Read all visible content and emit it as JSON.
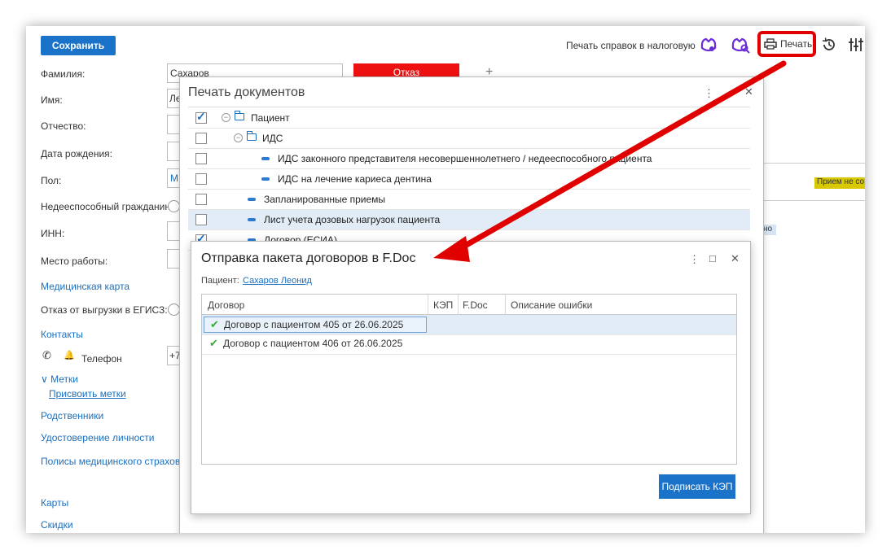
{
  "toolbar": {
    "save_label": "Сохранить",
    "print_tax_label": "Печать справок в налоговую",
    "print_label": "Печать"
  },
  "form": {
    "fields": [
      {
        "label": "Фамилия:",
        "value": "Сахаров"
      },
      {
        "label": "Имя:",
        "value": "Ле"
      },
      {
        "label": "Отчество:",
        "value": ""
      },
      {
        "label": "Дата рождения:",
        "value": ""
      },
      {
        "label": "Пол:",
        "value": "М"
      },
      {
        "label": "Недееспособный гражданин:",
        "value": ""
      },
      {
        "label": "ИНН:",
        "value": ""
      },
      {
        "label": "Место работы:",
        "value": ""
      }
    ],
    "medcard_link": "Медицинская карта",
    "egisz_label": "Отказ от выгрузки в ЕГИСЗ:",
    "contacts_link": "Контакты",
    "phone_label": "Телефон",
    "phone_value": "+7",
    "tags_label": "Метки",
    "assign_tags_link": "Присвоить метки",
    "relatives_link": "Родственники",
    "id_link": "Удостоверение личности",
    "policies_link": "Полисы медицинского страхован",
    "cards_link": "Карты",
    "discounts_link": "Скидки"
  },
  "background": {
    "red_tab_label": "Отказ",
    "plus_label": "+",
    "yellow_badge": "Прием не со",
    "blue_badge": "но",
    "colors": {
      "red": "#ee1111",
      "yellow": "#d7c800",
      "blue": "#1a73c9"
    }
  },
  "print_dialog": {
    "title": "Печать документов",
    "rows": [
      {
        "label": "Пациент",
        "checked": true
      },
      {
        "label": "ИДС",
        "checked": false
      },
      {
        "label": "ИДС законного представителя несовершеннолетнего / недееспособного пациента",
        "checked": false
      },
      {
        "label": "ИДС на лечение кариеса дентина",
        "checked": false
      },
      {
        "label": "Запланированные приемы",
        "checked": false
      },
      {
        "label": "Лист учета дозовых нагрузок пациента",
        "checked": false
      },
      {
        "label": "Договор (ЕСИА)",
        "checked": true
      }
    ]
  },
  "fdoc_dialog": {
    "title": "Отправка пакета договоров в F.Doc",
    "patient_label": "Пациент:",
    "patient_name": "Сахаров Леонид",
    "columns": [
      "Договор",
      "КЭП",
      "F.Doc",
      "Описание ошибки"
    ],
    "rows": [
      {
        "contract": "Договор с пациентом 405 от 26.06.2025",
        "kep": "",
        "fdoc": "",
        "error": ""
      },
      {
        "contract": "Договор с пациентом 406 от 26.06.2025",
        "kep": "",
        "fdoc": "",
        "error": ""
      }
    ],
    "sign_button": "Подписать КЭП"
  }
}
